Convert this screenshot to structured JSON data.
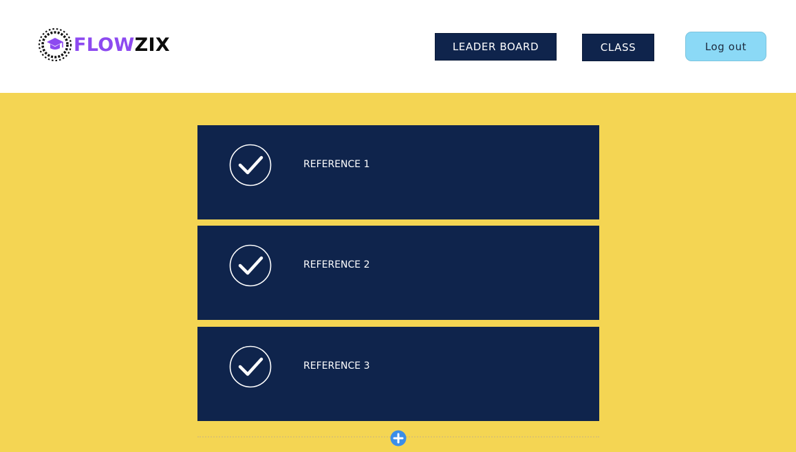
{
  "brand": {
    "name_part_1": "FLOW",
    "name_part_2": "ZIX",
    "emblem_icon": "graduation-cap-laurel-icon",
    "colors": {
      "accent": "#8d4af0",
      "dark": "#0c0c0c"
    }
  },
  "nav": {
    "leaderboard_label": "LEADER BOARD",
    "class_label": "CLASS",
    "logout_label": "Log out"
  },
  "references": [
    {
      "label": "REFERENCE 1",
      "icon": "check-circle-icon"
    },
    {
      "label": "REFERENCE 2",
      "icon": "check-circle-icon"
    },
    {
      "label": "REFERENCE 3",
      "icon": "check-circle-icon"
    }
  ],
  "add_section": {
    "icon": "plus-circle-icon"
  },
  "colors": {
    "background": "#f4d553",
    "card": "#0f244c",
    "logout_button": "#8bd9f6",
    "add_button": "#3b8ee8"
  }
}
